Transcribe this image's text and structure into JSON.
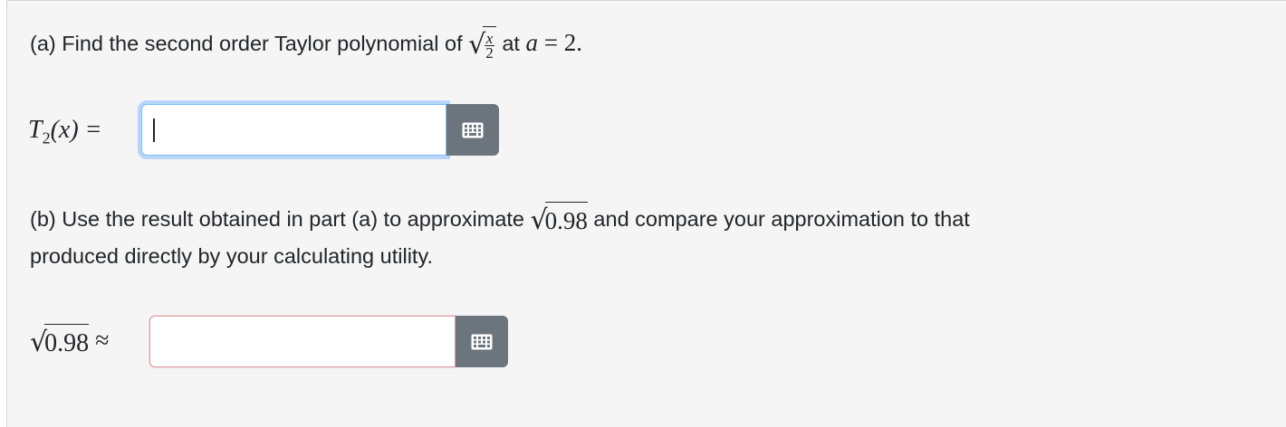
{
  "part_a": {
    "prefix": "(a) Find the second order Taylor polynomial of ",
    "frac_num": "x",
    "frac_den": "2",
    "at_word": " at ",
    "var_a": "a",
    "equals_value": " = 2."
  },
  "answer_a": {
    "label_T": "T",
    "label_sub": "2",
    "label_rest": "(x) =",
    "value": ""
  },
  "part_b": {
    "line1_prefix": "(b) Use the result obtained in part (a) to approximate ",
    "radicand": "0.98",
    "line1_suffix": " and compare your approximation to that",
    "line2": "produced directly by your calculating utility."
  },
  "answer_b": {
    "label_radicand": "0.98",
    "label_approx": "≈",
    "value": ""
  },
  "icons": {
    "keyboard": "keyboard-icon"
  },
  "colors": {
    "panel_bg": "#f5f5f5",
    "button_bg": "#6c757d",
    "focus_border": "#80bdff",
    "invalid_border": "#d9a0a6"
  }
}
